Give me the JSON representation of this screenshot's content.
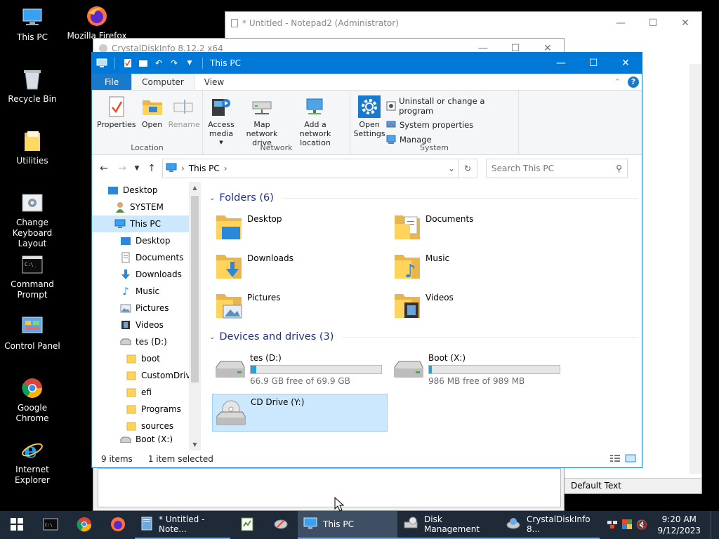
{
  "desktop": {
    "icons": [
      {
        "label": "This PC"
      },
      {
        "label": "Mozilla Firefox"
      },
      {
        "label": "Recycle Bin"
      },
      {
        "label": "Utilities"
      },
      {
        "label": "Change Keyboard Layout"
      },
      {
        "label": "Command Prompt"
      },
      {
        "label": "Control Panel"
      },
      {
        "label": "Google Chrome"
      },
      {
        "label": "Internet Explorer"
      }
    ]
  },
  "background_windows": {
    "notepad": {
      "title": "* Untitled - Notepad2 (Administrator)",
      "status": "Default Text"
    },
    "crystaldisk": {
      "title": "CrystalDiskInfo 8.12.2 x64"
    }
  },
  "explorer": {
    "title": "This PC",
    "tabs": {
      "file": "File",
      "computer": "Computer",
      "view": "View"
    },
    "ribbon": {
      "location": {
        "label": "Location",
        "properties": "Properties",
        "open": "Open",
        "rename": "Rename"
      },
      "network": {
        "label": "Network",
        "access_media": "Access media",
        "map_drive": "Map network drive",
        "add_location": "Add a network location"
      },
      "system": {
        "label": "System",
        "open_settings": "Open Settings",
        "uninstall": "Uninstall or change a program",
        "properties": "System properties",
        "manage": "Manage"
      }
    },
    "address": {
      "path": "This PC",
      "search_placeholder": "Search This PC"
    },
    "nav": [
      {
        "label": "Desktop"
      },
      {
        "label": "SYSTEM"
      },
      {
        "label": "This PC"
      },
      {
        "label": "Desktop"
      },
      {
        "label": "Documents"
      },
      {
        "label": "Downloads"
      },
      {
        "label": "Music"
      },
      {
        "label": "Pictures"
      },
      {
        "label": "Videos"
      },
      {
        "label": "tes (D:)"
      },
      {
        "label": "boot"
      },
      {
        "label": "CustomDrive"
      },
      {
        "label": "efi"
      },
      {
        "label": "Programs"
      },
      {
        "label": "sources"
      },
      {
        "label": "Boot (X:)"
      }
    ],
    "folders_header": "Folders (6)",
    "folders": [
      {
        "name": "Desktop"
      },
      {
        "name": "Documents"
      },
      {
        "name": "Downloads"
      },
      {
        "name": "Music"
      },
      {
        "name": "Pictures"
      },
      {
        "name": "Videos"
      }
    ],
    "drives_header": "Devices and drives (3)",
    "drives": [
      {
        "name": "tes (D:)",
        "free": "66.9 GB free of 69.9 GB",
        "used_fraction": 0.043
      },
      {
        "name": "Boot (X:)",
        "free": "986 MB free of 989 MB",
        "used_fraction": 0.003
      },
      {
        "name": "CD Drive (Y:)"
      }
    ],
    "status": {
      "items": "9 items",
      "selected": "1 item selected"
    }
  },
  "taskbar": {
    "tasks": [
      {
        "label": "* Untitled - Note..."
      },
      {
        "label": "This PC"
      },
      {
        "label": "Disk Management"
      },
      {
        "label": "CrystalDiskInfo 8..."
      }
    ],
    "clock": {
      "time": "9:20 AM",
      "date": "9/12/2023"
    }
  }
}
